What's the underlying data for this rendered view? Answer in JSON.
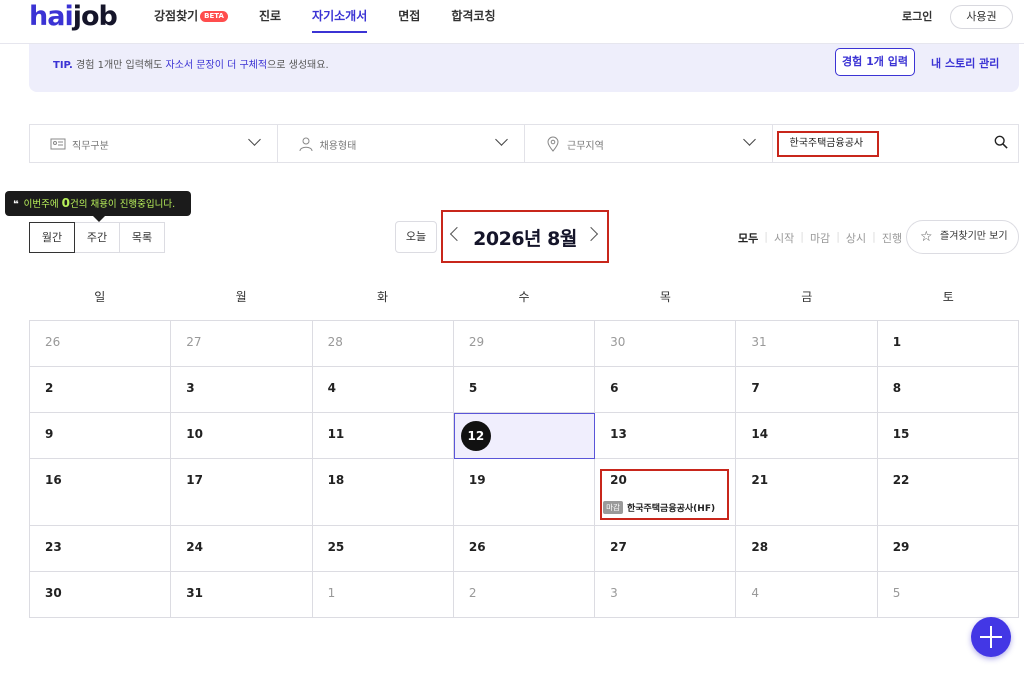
{
  "header": {
    "logo_part1": "hai",
    "logo_part2": "job",
    "nav": [
      {
        "label": "강점찾기",
        "badge": "BETA"
      },
      {
        "label": "진로"
      },
      {
        "label": "자기소개서"
      },
      {
        "label": "면접"
      },
      {
        "label": "합격코칭"
      }
    ],
    "active_nav": "자기소개서",
    "login_label": "로그인",
    "voucher_label": "사용권"
  },
  "tip": {
    "label": "TIP.",
    "text_before": " 경험 1개만 입력해도 ",
    "highlight": "자소서 문장이 더 구체적",
    "text_after": "으로 생성돼요.",
    "button_label": "경험 1개 입력",
    "link_label": "내 스토리 관리"
  },
  "filters": {
    "job_category": "직무구분",
    "employment_type": "채용형태",
    "location": "근무지역",
    "search_value": "한국주택금융공사"
  },
  "tooltip": {
    "pre": "이번주에 ",
    "count": "0",
    "post": "건의 채용이 진행중입니다."
  },
  "view_tabs": [
    "월간",
    "주간",
    "목록"
  ],
  "active_view": "월간",
  "month_nav": {
    "today_label": "오늘",
    "title": "2026년 8월"
  },
  "status_filters": [
    "모두",
    "시작",
    "마감",
    "상시",
    "진행"
  ],
  "active_status": "모두",
  "favorites_label": "즐겨찾기만 보기",
  "calendar": {
    "weekdays": [
      "일",
      "월",
      "화",
      "수",
      "목",
      "금",
      "토"
    ],
    "weeks": [
      [
        "26",
        "27",
        "28",
        "29",
        "30",
        "31",
        "1"
      ],
      [
        "2",
        "3",
        "4",
        "5",
        "6",
        "7",
        "8"
      ],
      [
        "9",
        "10",
        "11",
        "12",
        "13",
        "14",
        "15"
      ],
      [
        "16",
        "17",
        "18",
        "19",
        "20",
        "21",
        "22"
      ],
      [
        "23",
        "24",
        "25",
        "26",
        "27",
        "28",
        "29"
      ],
      [
        "30",
        "31",
        "1",
        "2",
        "3",
        "4",
        "5"
      ]
    ],
    "today": "12",
    "event": {
      "tag": "마감",
      "name": "한국주택금융공사(HF)"
    }
  },
  "colors": {
    "brand": "#3b33d4",
    "highlight_box": "#c8261b",
    "tooltip_accent": "#b8f05a"
  }
}
